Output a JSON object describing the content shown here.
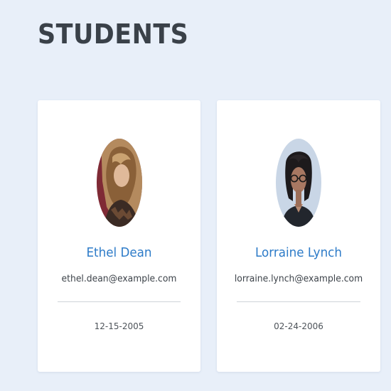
{
  "page": {
    "title": "STUDENTS"
  },
  "students": [
    {
      "name": "Ethel Dean",
      "email": "ethel.dean@example.com",
      "date": "12-15-2005",
      "avatar_icon": "student-photo"
    },
    {
      "name": "Lorraine Lynch",
      "email": "lorraine.lynch@example.com",
      "date": "02-24-2006",
      "avatar_icon": "student-photo"
    }
  ],
  "colors": {
    "background": "#e8eff9",
    "card": "#ffffff",
    "title": "#3a4149",
    "name": "#2d7bc8",
    "text": "#3d434a",
    "divider": "#cfd4d9"
  }
}
